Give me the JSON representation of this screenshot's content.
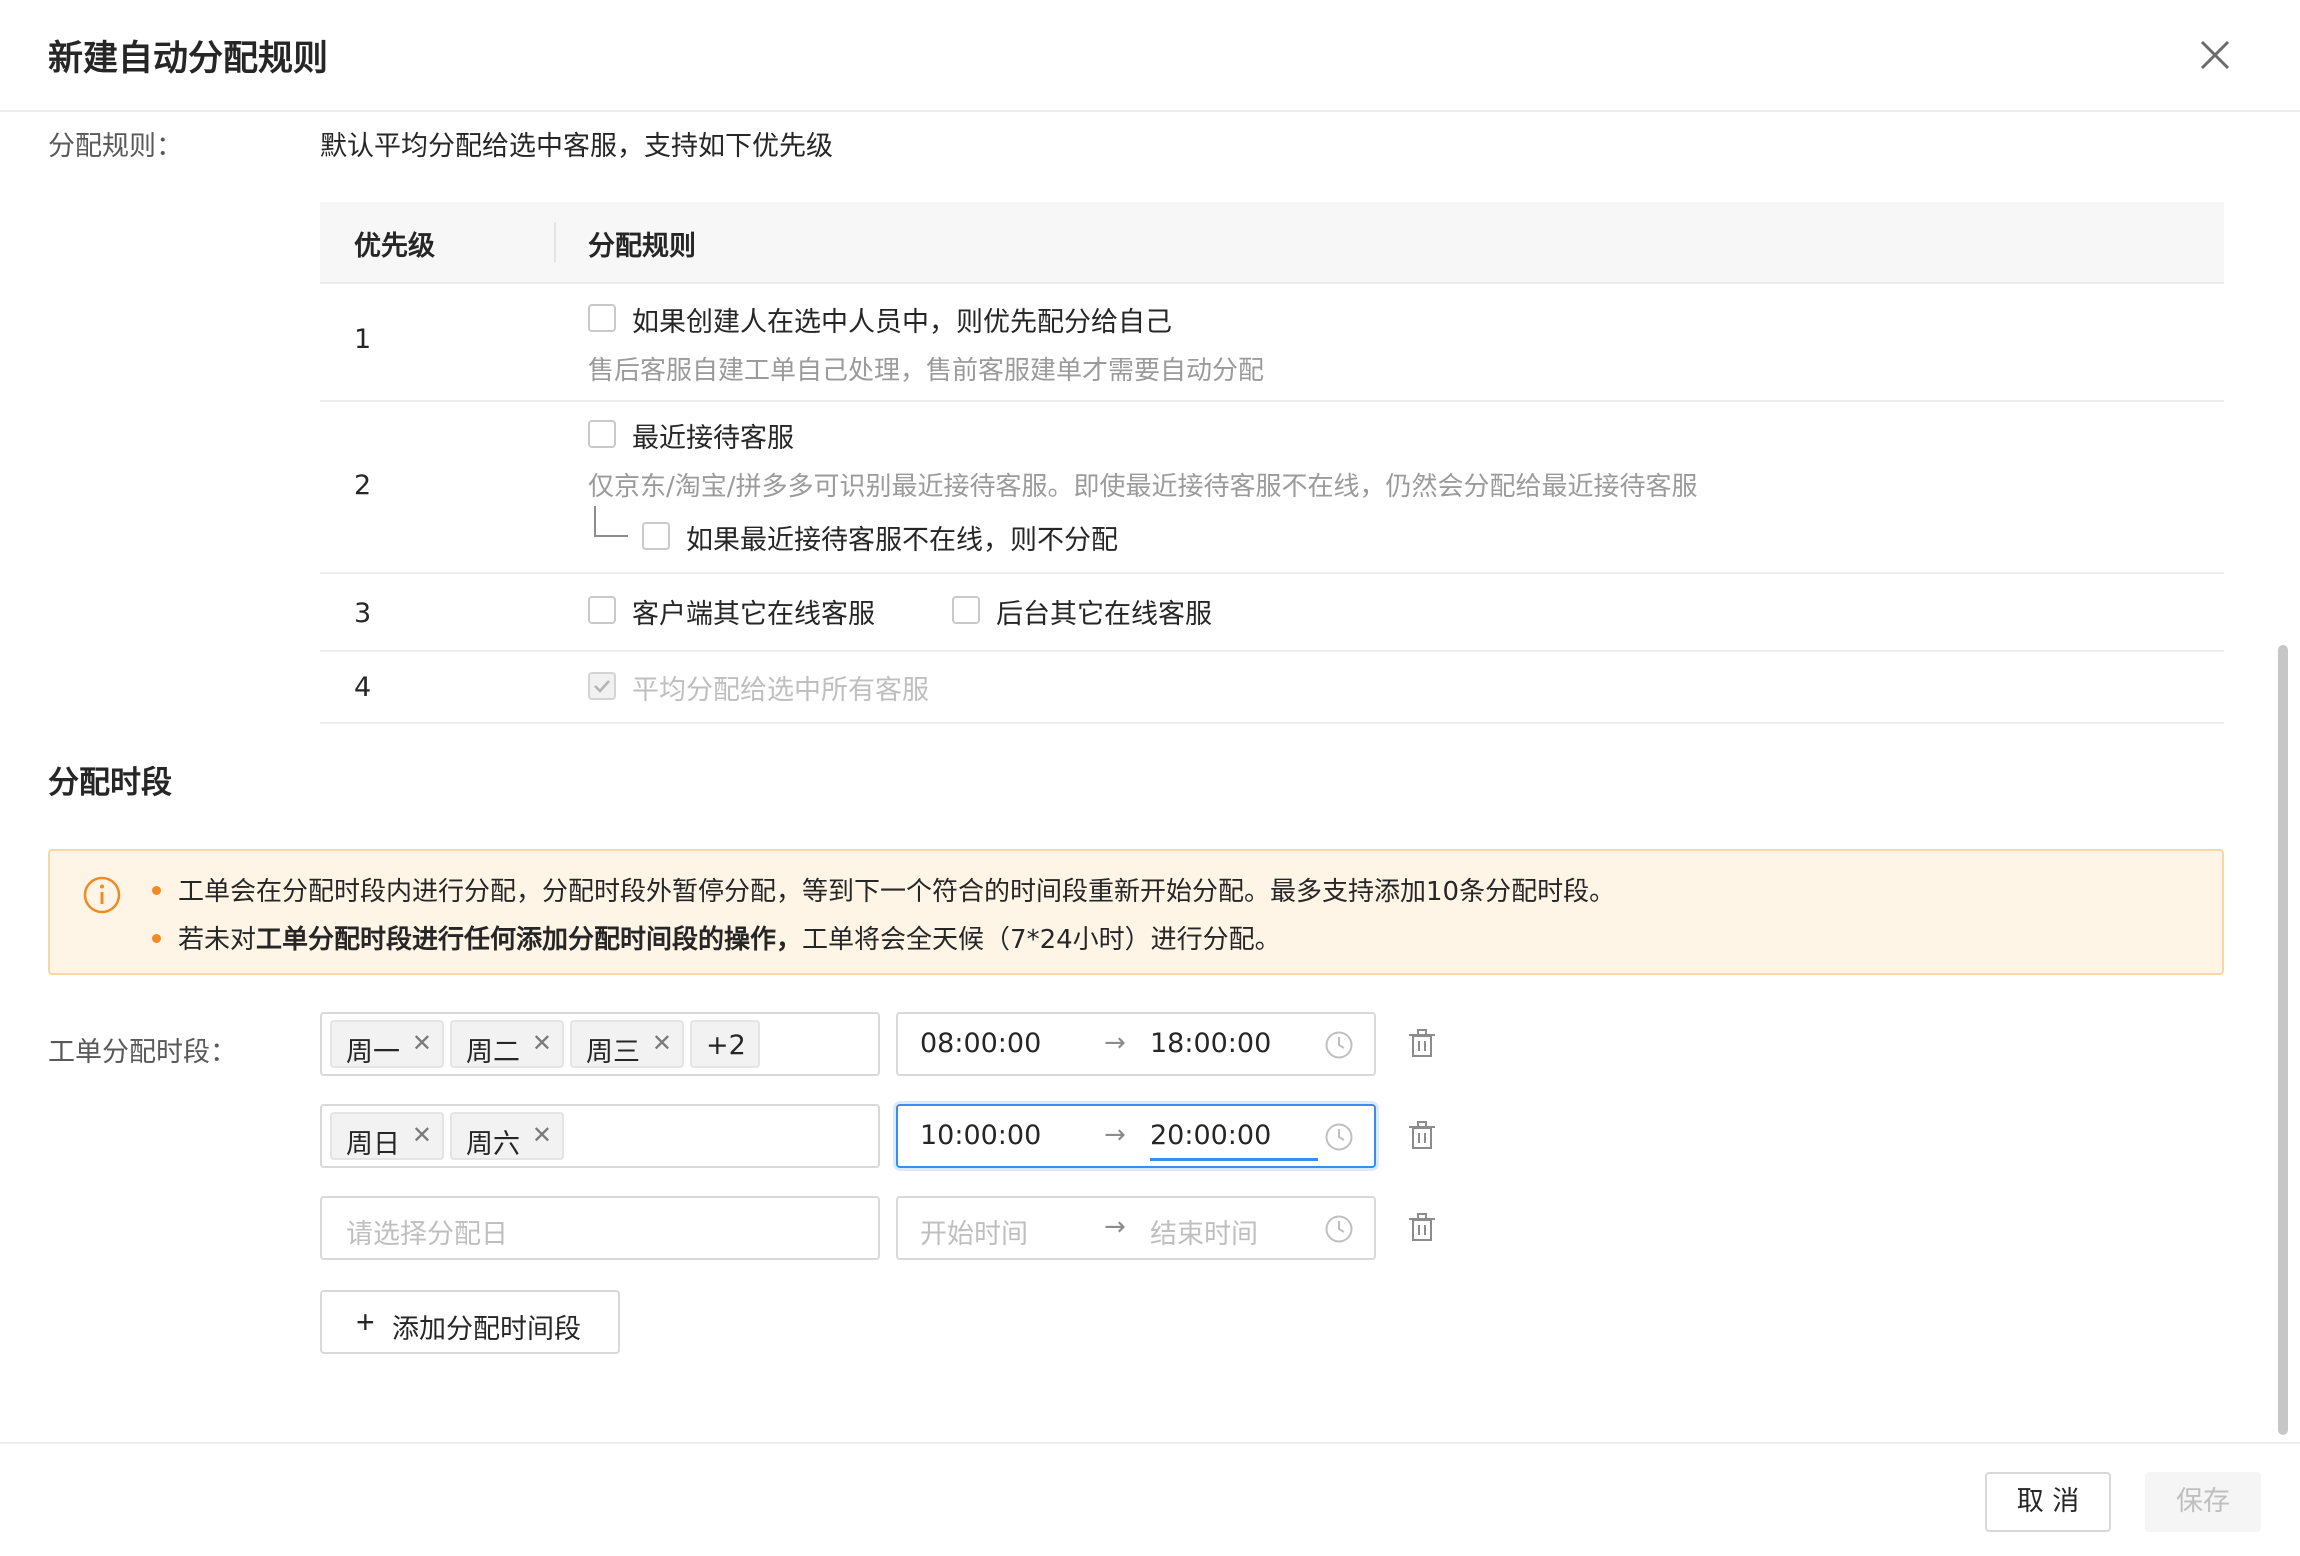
{
  "dialog": {
    "title": "新建自动分配规则"
  },
  "rule": {
    "label": "分配规则：",
    "intro": "默认平均分配给选中客服，支持如下优先级",
    "headers": {
      "priority": "优先级",
      "rule": "分配规则"
    },
    "rows": [
      {
        "priority": "1",
        "option": "如果创建人在选中人员中，则优先配分给自己",
        "hint": "售后客服自建工单自己处理，售前客服建单才需要自动分配"
      },
      {
        "priority": "2",
        "option": "最近接待客服",
        "hint": "仅京东/淘宝/拼多多可识别最近接待客服。即使最近接待客服不在线，仍然会分配给最近接待客服",
        "sub_option": "如果最近接待客服不在线，则不分配"
      },
      {
        "priority": "3",
        "option_a": "客户端其它在线客服",
        "option_b": "后台其它在线客服"
      },
      {
        "priority": "4",
        "option": "平均分配给选中所有客服",
        "checked": true,
        "disabled": true
      }
    ]
  },
  "period": {
    "section_title": "分配时段",
    "alert": {
      "line1": "工单会在分配时段内进行分配，分配时段外暂停分配，等到下一个符合的时间段重新开始分配。最多支持添加10条分配时段。",
      "line2_prefix": "若未对",
      "line2_bold": "工单分配时段进行任何添加分配时间段的操作，",
      "line2_suffix": "工单将会全天候（7*24小时）进行分配。"
    },
    "field_label": "工单分配时段：",
    "rows": [
      {
        "days": [
          "周一",
          "周二",
          "周三"
        ],
        "more": "+2",
        "start": "08:00:00",
        "end": "18:00:00"
      },
      {
        "days": [
          "周日",
          "周六"
        ],
        "start": "10:00:00",
        "end": "20:00:00"
      },
      {
        "day_placeholder": "请选择分配日",
        "start_placeholder": "开始时间",
        "end_placeholder": "结束时间"
      }
    ],
    "arrow": "→",
    "add_button": "添加分配时间段"
  },
  "footer": {
    "cancel": "取 消",
    "save": "保存"
  },
  "colors": {
    "accent": "#3a8df0",
    "warning": "#f08a24",
    "alert_bg": "#fef5e7"
  }
}
